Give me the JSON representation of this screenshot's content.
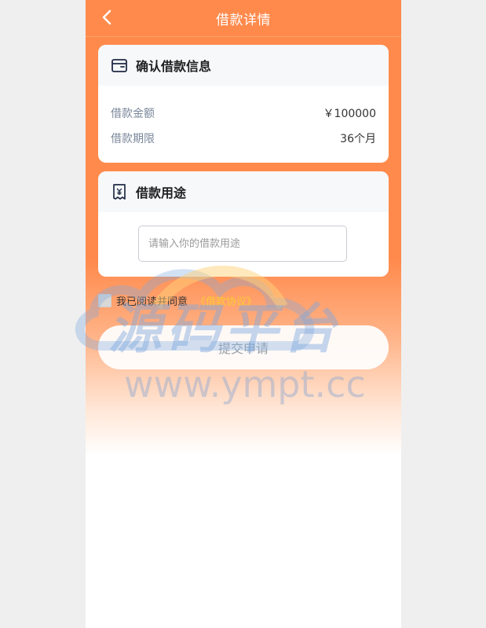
{
  "header": {
    "title": "借款详情",
    "back_icon": "chevron-left-icon"
  },
  "loan_info": {
    "title": "确认借款信息",
    "icon": "wallet-icon",
    "rows": [
      {
        "label": "借款金额",
        "value": "￥100000"
      },
      {
        "label": "借款期限",
        "value": "36个月"
      }
    ]
  },
  "purpose": {
    "title": "借款用途",
    "icon": "receipt-icon",
    "placeholder": "请输入你的借款用途",
    "value": ""
  },
  "agreement": {
    "text": "我已阅读并同意",
    "link": "《借款协议》"
  },
  "submit_label": "提交申请",
  "watermark": {
    "text": "源码平台",
    "url": "www.ympt.cc"
  },
  "colors": {
    "primary": "#ff8a4c",
    "link": "#ffcc33"
  }
}
